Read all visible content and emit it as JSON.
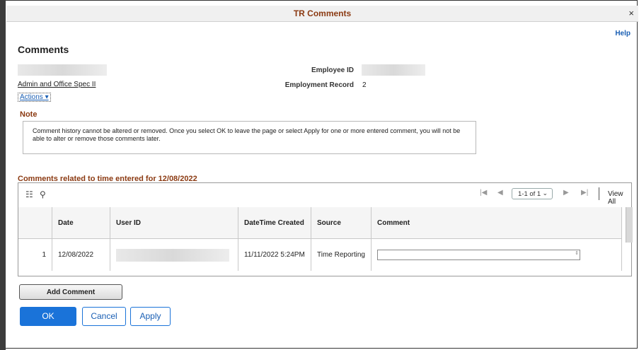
{
  "window": {
    "title": "TR Comments",
    "close_icon": "×"
  },
  "help_link": "Help",
  "page_title": "Comments",
  "employee": {
    "job_title": "Admin and Office Spec II",
    "actions_label": "Actions ▾",
    "employee_id_label": "Employee ID",
    "employment_record_label": "Employment Record",
    "employment_record_value": "2"
  },
  "note": {
    "title": "Note",
    "text": "Comment history cannot be altered or removed. Once you select OK to leave the page or select Apply for one or more entered comment, you will not be able to alter or remove those comments later."
  },
  "section_title": "Comments related to time entered for 12/08/2022",
  "grid": {
    "pager_text": "1-1 of 1",
    "view_all": "View All",
    "columns": [
      "",
      "Date",
      "User ID",
      "DateTime Created",
      "Source",
      "Comment"
    ],
    "rows": [
      {
        "num": "1",
        "date": "12/08/2022",
        "user_id": "",
        "datetime_created": "11/11/2022  5:24PM",
        "source": "Time Reporting",
        "comment": ""
      }
    ]
  },
  "buttons": {
    "add_comment": "Add Comment",
    "ok": "OK",
    "cancel": "Cancel",
    "apply": "Apply"
  },
  "colors": {
    "accent": "#1a73d9",
    "section_title": "#8b3a12"
  }
}
